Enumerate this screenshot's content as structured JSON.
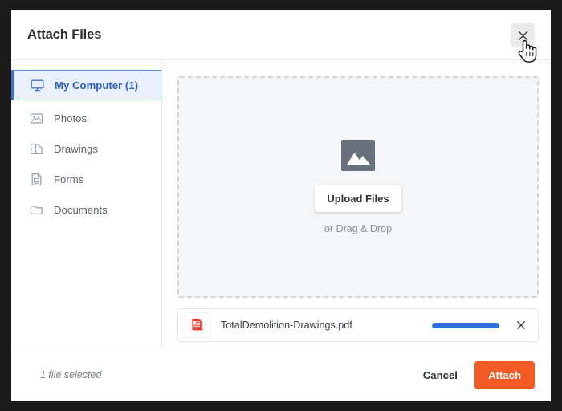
{
  "dialog": {
    "title": "Attach Files",
    "close_icon": "close-icon"
  },
  "sidebar": {
    "items": [
      {
        "label": "My Computer (1)",
        "icon": "monitor-icon",
        "selected": true
      },
      {
        "label": "Photos",
        "icon": "photo-icon",
        "selected": false
      },
      {
        "label": "Drawings",
        "icon": "drawings-icon",
        "selected": false
      },
      {
        "label": "Forms",
        "icon": "form-icon",
        "selected": false
      },
      {
        "label": "Documents",
        "icon": "folder-icon",
        "selected": false
      }
    ]
  },
  "dropzone": {
    "icon": "image-placeholder-icon",
    "button_label": "Upload Files",
    "hint": "or Drag & Drop"
  },
  "file_row": {
    "icon": "pdf-file-icon",
    "name": "TotalDemolition-Drawings.pdf",
    "progress_percent": 100,
    "remove_icon": "close-icon"
  },
  "footer": {
    "status": "1 file selected",
    "cancel_label": "Cancel",
    "attach_label": "Attach"
  },
  "colors": {
    "accent_orange": "#f15a22",
    "accent_blue": "#2f6fdb",
    "selected_blue_bg": "#e9f0fb",
    "selected_blue_text": "#2c62bd",
    "dropzone_bg": "#f4f6f8",
    "pdf_red": "#e03a33"
  },
  "cursor": {
    "type": "pointer-hand-cursor"
  }
}
